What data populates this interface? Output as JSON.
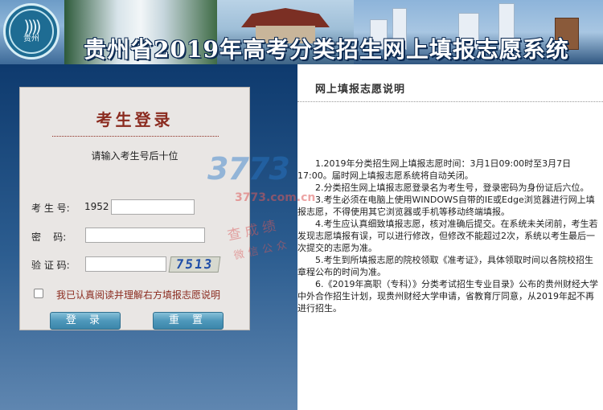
{
  "banner": {
    "title": "贵州省2019年高考分类招生网上填报志愿系统",
    "logo_text": "贵州"
  },
  "login": {
    "title": "考生登录",
    "hint": "请输入考生号后十位",
    "exam_id_label": "考 生 号:",
    "exam_id_prefix": "1952",
    "password_label": "密    码:",
    "captcha_label": "验 证 码:",
    "captcha_image_text": "7513",
    "agree_text": "我已认真阅读并理解右方填报志愿说明",
    "login_button": "登 录",
    "reset_button": "重 置"
  },
  "instructions": {
    "heading": "网上填报志愿说明",
    "items": [
      "1.2019年分类招生网上填报志愿时间：3月1日09:00时至3月7日17:00。届时网上填报志愿系统将自动关闭。",
      "2.分类招生网上填报志愿登录名为考生号，登录密码为身份证后六位。",
      "3.考生必须在电脑上使用WINDOWS自带的IE或Edge浏览器进行网上填报志愿，不得使用其它浏览器或手机等移动终端填报。",
      "4.考生应认真细致填报志愿，核对准确后提交。在系统未关闭前，考生若发现志愿填报有误，可以进行修改，但修改不能超过2次，系统以考生最后一次提交的志愿为准。",
      "5.考生到所填报志愿的院校领取《准考证》，具体领取时间以各院校招生章程公布的时间为准。",
      "6.《2019年高职（专科）》分类考试招生专业目录》公布的贵州财经大学中外合作招生计划，现贵州财经大学申请，省教育厅同意，从2019年起不再进行招生。"
    ]
  },
  "watermark": {
    "brand": "3773",
    "site": "3773.com.cn",
    "line1": "查成绩",
    "line2": "微信公众"
  },
  "colors": {
    "title_red": "#8b2b1f",
    "button_blue": "#4e98bb",
    "page_navy": "#1d4a7e"
  }
}
